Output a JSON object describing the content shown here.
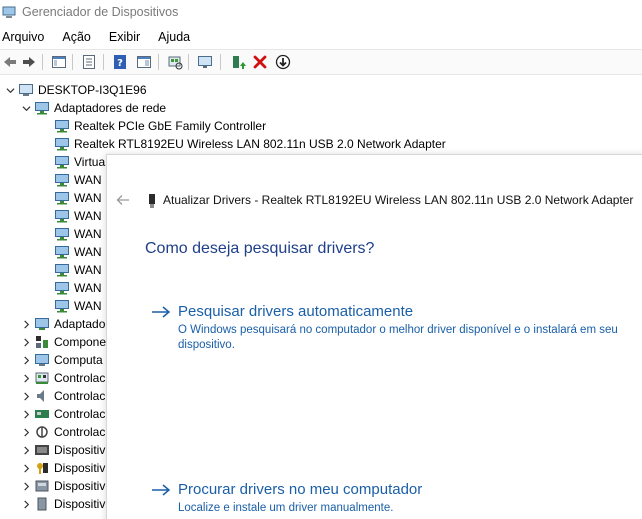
{
  "window": {
    "title": "Gerenciador de Dispositivos"
  },
  "menu": [
    "Arquivo",
    "Ação",
    "Exibir",
    "Ajuda"
  ],
  "toolbar": {
    "icons": [
      "back-icon",
      "forward-icon",
      "show-hide-console-tree-icon",
      "properties-icon",
      "help-icon",
      "action-pane-icon",
      "scan-hardware-icon",
      "monitor-icon",
      "update-driver-icon",
      "uninstall-icon",
      "disable-device-icon"
    ]
  },
  "tree": {
    "root": "DESKTOP-I3Q1E96",
    "network_category": "Adaptadores de rede",
    "network_items": [
      "Realtek PCIe GbE Family Controller",
      "Realtek RTL8192EU Wireless LAN 802.11n USB 2.0 Network Adapter",
      "Virtua",
      "WAN",
      "WAN",
      "WAN",
      "WAN",
      "WAN",
      "WAN",
      "WAN",
      "WAN"
    ],
    "collapsed_categories": [
      "Adaptado",
      "Compone",
      "Computa",
      "Controlac",
      "Controlac",
      "Controlac",
      "Controlac",
      "Dispositiv",
      "Dispositiv",
      "Dispositiv",
      "Dispositiv"
    ]
  },
  "dialog": {
    "title": "Atualizar Drivers - Realtek RTL8192EU Wireless LAN 802.11n USB 2.0 Network Adapter",
    "heading": "Como deseja pesquisar drivers?",
    "options": [
      {
        "label": "Pesquisar drivers automaticamente",
        "description": "O Windows pesquisará no computador o melhor driver disponível e o instalará em seu dispositivo."
      },
      {
        "label": "Procurar drivers no meu computador",
        "description": "Localize e instale um driver manualmente."
      }
    ]
  },
  "colors": {
    "link": "#1a5fa8",
    "heading": "#1f3f8a",
    "title_gray": "#7a7a7a",
    "uninstall_red": "#d01010"
  }
}
